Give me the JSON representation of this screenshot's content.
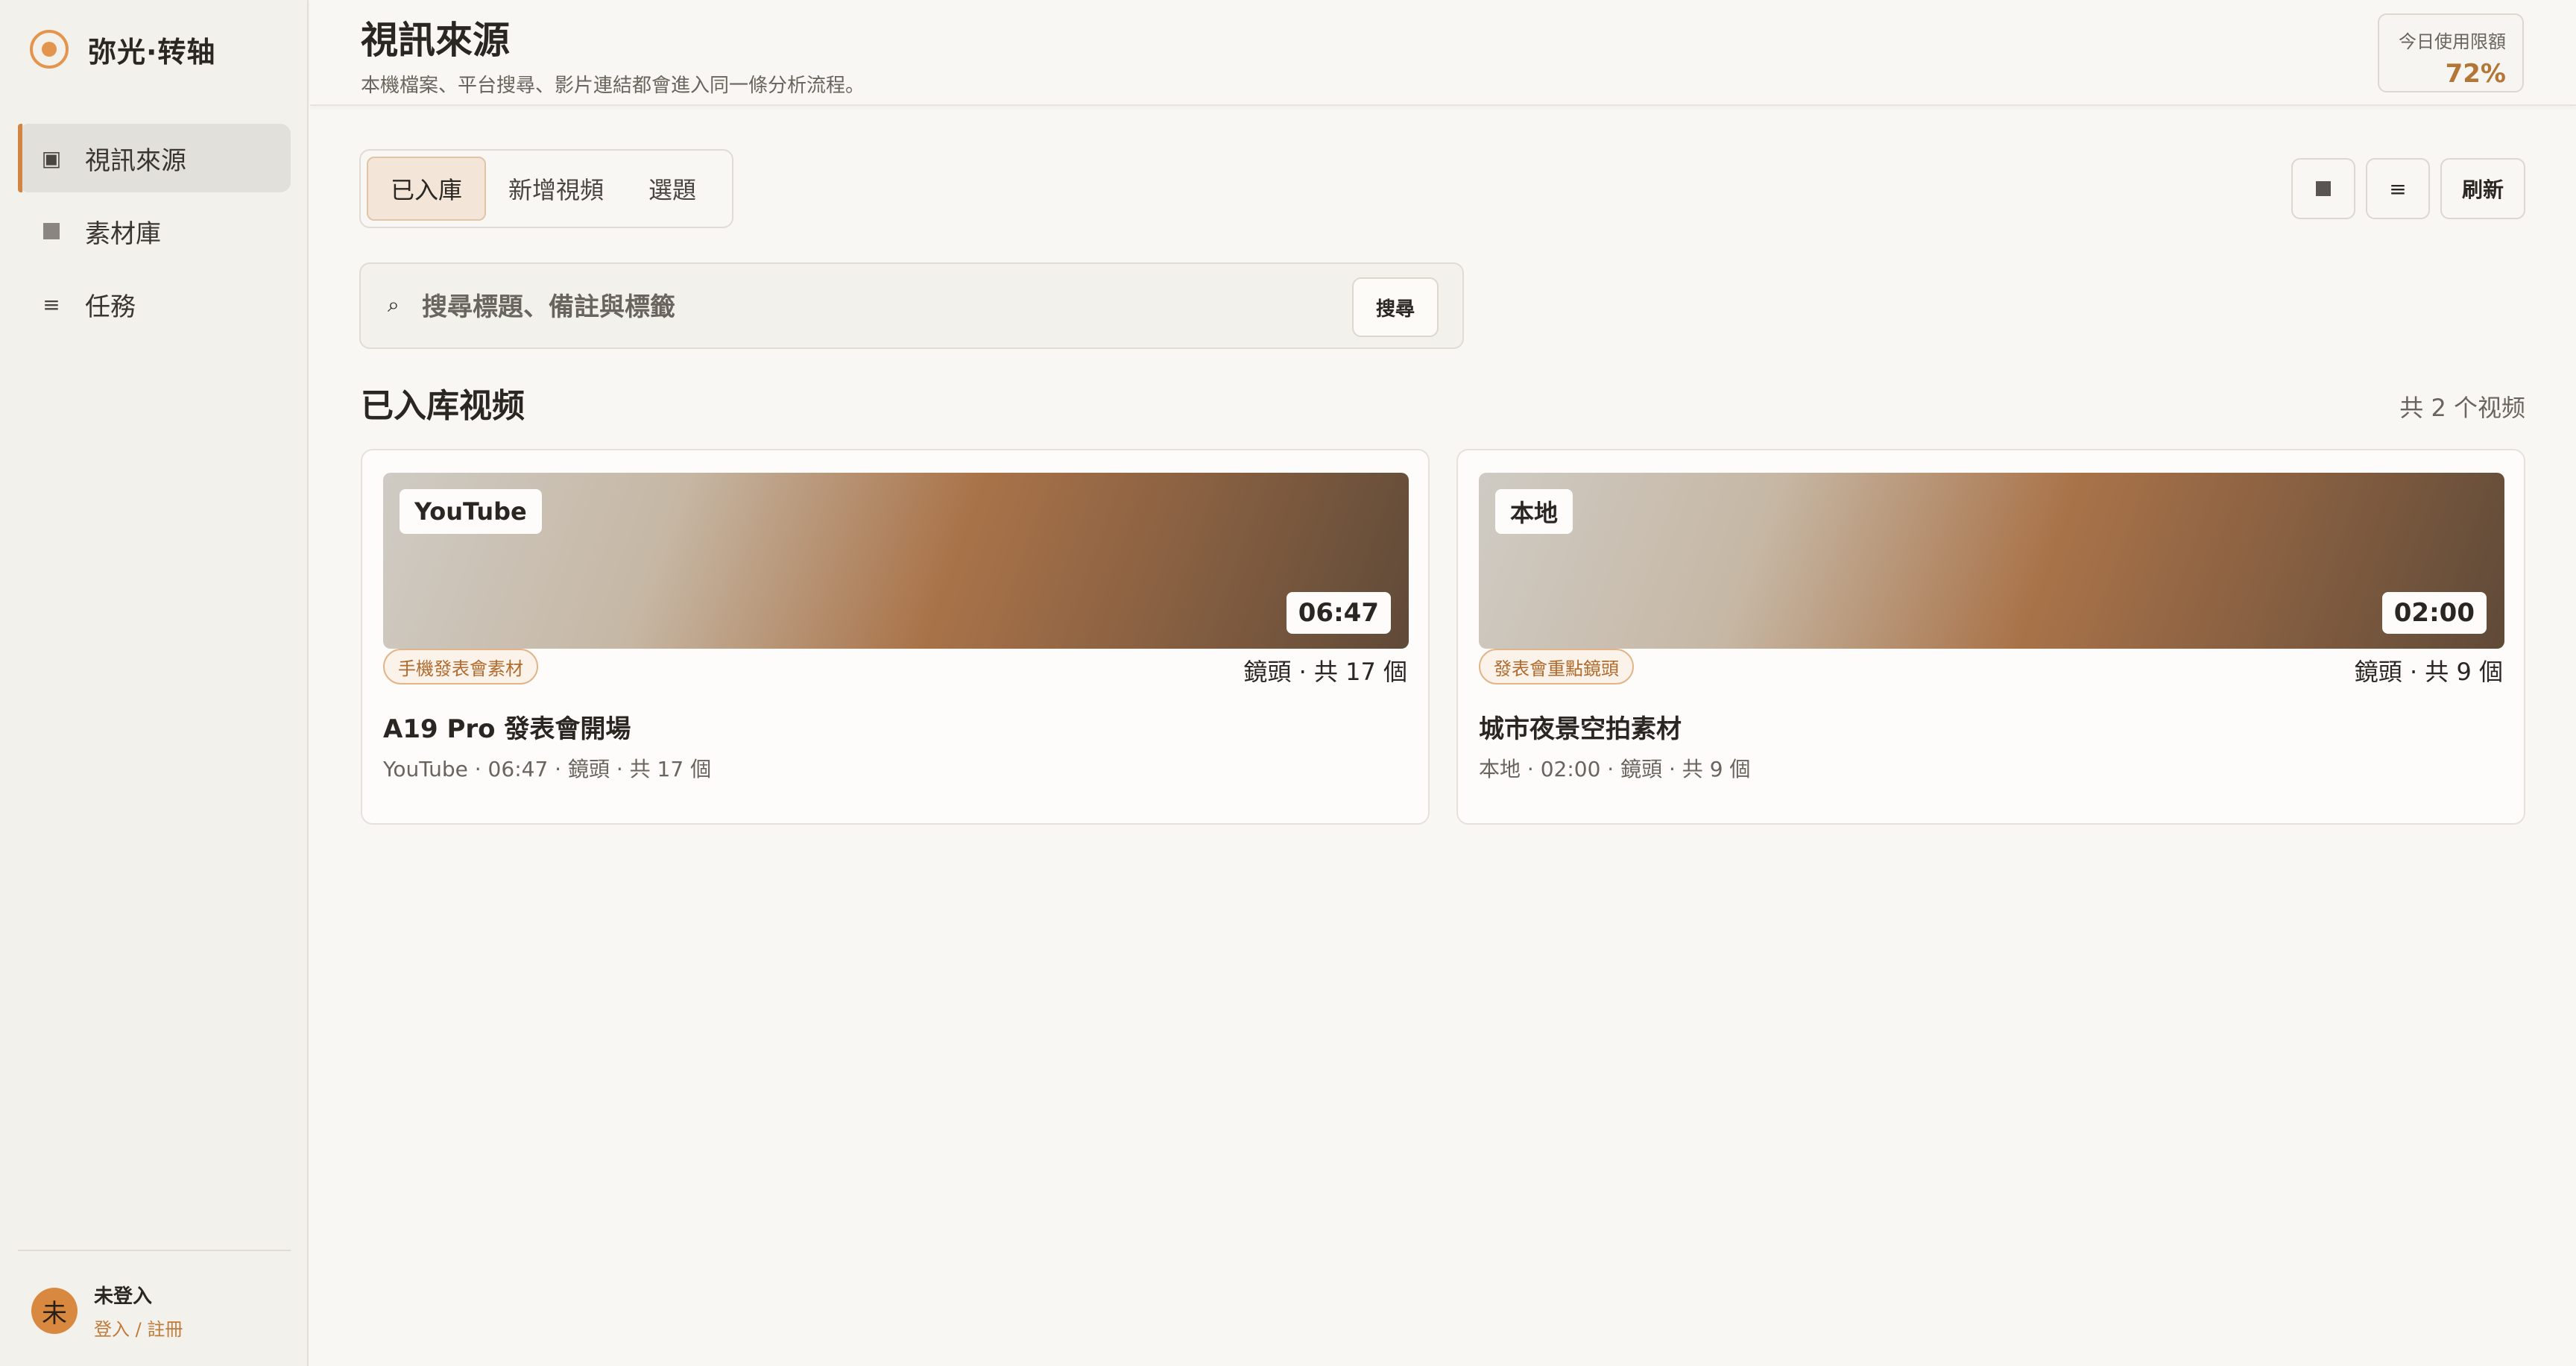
{
  "brand": {
    "name": "弥光·转轴"
  },
  "sidebar": {
    "items": [
      {
        "label": "視訊來源",
        "icon": "video-source-icon",
        "active": true
      },
      {
        "label": "素材庫",
        "icon": "library-icon",
        "active": false
      },
      {
        "label": "任務",
        "icon": "tasks-icon",
        "active": false
      }
    ],
    "user": {
      "avatar": "未",
      "name": "未登入",
      "link": "登入 / 註冊"
    }
  },
  "header": {
    "title": "視訊來源",
    "subtitle": "本機檔案、平台搜尋、影片連結都會進入同一條分析流程。",
    "quota": {
      "label": "今日使用限額",
      "value": "72%"
    }
  },
  "tabs": [
    {
      "label": "已入庫",
      "active": true
    },
    {
      "label": "新增視頻",
      "active": false
    },
    {
      "label": "選題",
      "active": false
    }
  ],
  "toolbar": {
    "grid_glyph": "■",
    "list_glyph": "≡",
    "refresh_label": "刷新"
  },
  "search": {
    "icon": "⌕",
    "placeholder": "搜尋標題、備註與標籤",
    "value": "",
    "button_label": "搜尋"
  },
  "section": {
    "title": "已入库视频",
    "count": "共 2 个视频"
  },
  "videos": [
    {
      "source": "YouTube",
      "duration": "06:47",
      "tag": "手機發表會素材",
      "shots": "鏡頭 · 共 17 個",
      "title": "A19 Pro 發表會開場",
      "meta": "YouTube · 06:47 · 鏡頭 · 共 17 個"
    },
    {
      "source": "本地",
      "duration": "02:00",
      "tag": "發表會重點鏡頭",
      "shots": "鏡頭 · 共 9 個",
      "title": "城市夜景空拍素材",
      "meta": "本地 · 02:00 · 鏡頭 · 共 9 個"
    }
  ],
  "colors": {
    "accent": "#d28443",
    "quota": "#b47636",
    "background": "#f9f7f3",
    "sidebar": "#f3f1ec"
  }
}
